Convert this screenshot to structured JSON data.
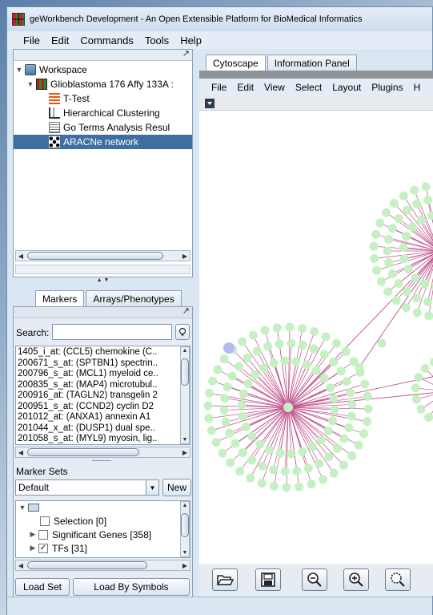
{
  "window": {
    "title": "geWorkbench Development - An Open Extensible Platform for BioMedical Informatics"
  },
  "menubar": [
    "File",
    "Edit",
    "Commands",
    "Tools",
    "Help"
  ],
  "project_tree": {
    "items": [
      {
        "label": "Workspace",
        "icon": "workspace-icon"
      },
      {
        "label": "Glioblastoma 176 Affy 133A :",
        "icon": "dataset-icon"
      },
      {
        "label": "T-Test",
        "icon": "ttest-icon"
      },
      {
        "label": "Hierarchical Clustering",
        "icon": "hierarchical-clustering-icon"
      },
      {
        "label": "Go Terms Analysis Resul",
        "icon": "go-terms-icon"
      },
      {
        "label": "ARACNe network",
        "icon": "network-icon",
        "selected": true
      }
    ]
  },
  "left_tabs": [
    "Markers",
    "Arrays/Phenotypes"
  ],
  "markers": {
    "search_label": "Search:",
    "search_value": "",
    "items": [
      "1405_i_at: (CCL5) chemokine (C..",
      "200671_s_at: (SPTBN1) spectrin..",
      "200796_s_at: (MCL1) myeloid ce..",
      "200835_s_at: (MAP4) microtubul..",
      "200916_at: (TAGLN2) transgelin 2",
      "200951_s_at: (CCND2) cyclin D2",
      "201012_at: (ANXA1) annexin A1",
      "201044_x_at: (DUSP1) dual spe..",
      "201058_s_at: (MYL9) myosin, lig.."
    ]
  },
  "marker_sets": {
    "label": "Marker Sets",
    "selected": "Default",
    "new_label": "New",
    "items": [
      {
        "label": "Selection [0]",
        "checked": false
      },
      {
        "label": "Significant Genes [358]",
        "checked": false
      },
      {
        "label": "TFs [31]",
        "checked": true
      }
    ],
    "load_set_label": "Load Set",
    "load_by_symbols_label": "Load By Symbols"
  },
  "right_tabs": [
    "Cytoscape",
    "Information Panel"
  ],
  "cytoscape_menu": [
    "File",
    "Edit",
    "View",
    "Select",
    "Layout",
    "Plugins",
    "H"
  ],
  "colors": {
    "node": "#c5f0c2",
    "node_highlight": "#b8b8f0",
    "edge": "#c0508a",
    "edge_light": "#d8a0bc",
    "selection": "#3f6fa0"
  },
  "toolbar_icons": [
    "open-icon",
    "save-icon",
    "zoom-out-icon",
    "zoom-in-icon",
    "zoom-selected-icon"
  ]
}
